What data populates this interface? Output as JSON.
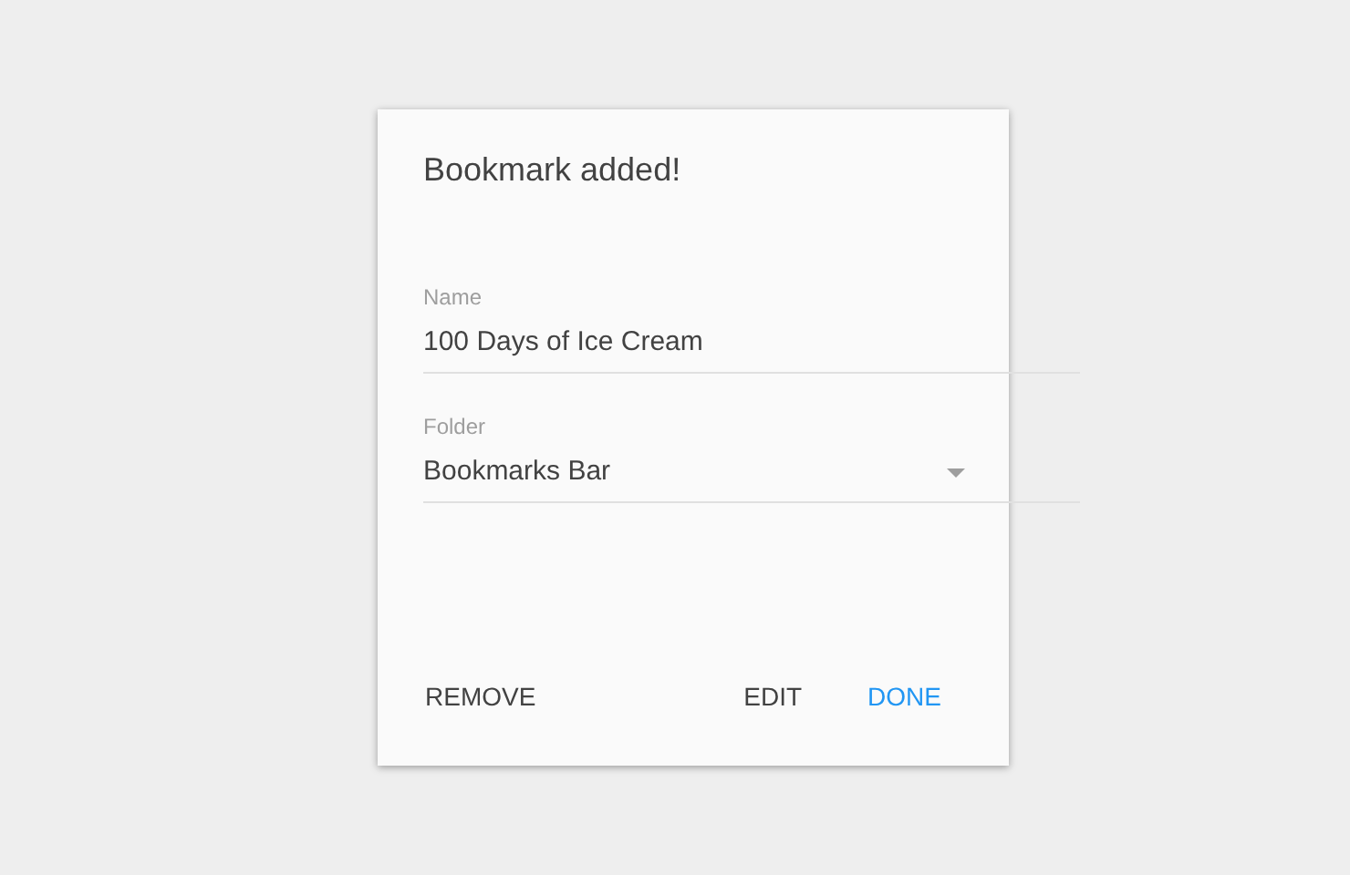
{
  "dialog": {
    "title": "Bookmark added!",
    "fields": [
      {
        "kind": "text",
        "label": "Name",
        "value": "100 Days of Ice Cream"
      },
      {
        "kind": "dropdown",
        "label": "Folder",
        "value": "Bookmarks Bar"
      }
    ],
    "buttons": [
      {
        "label": "REMOVE",
        "primary": false
      },
      {
        "label": "EDIT",
        "primary": false
      },
      {
        "label": "DONE",
        "primary": true
      }
    ]
  }
}
